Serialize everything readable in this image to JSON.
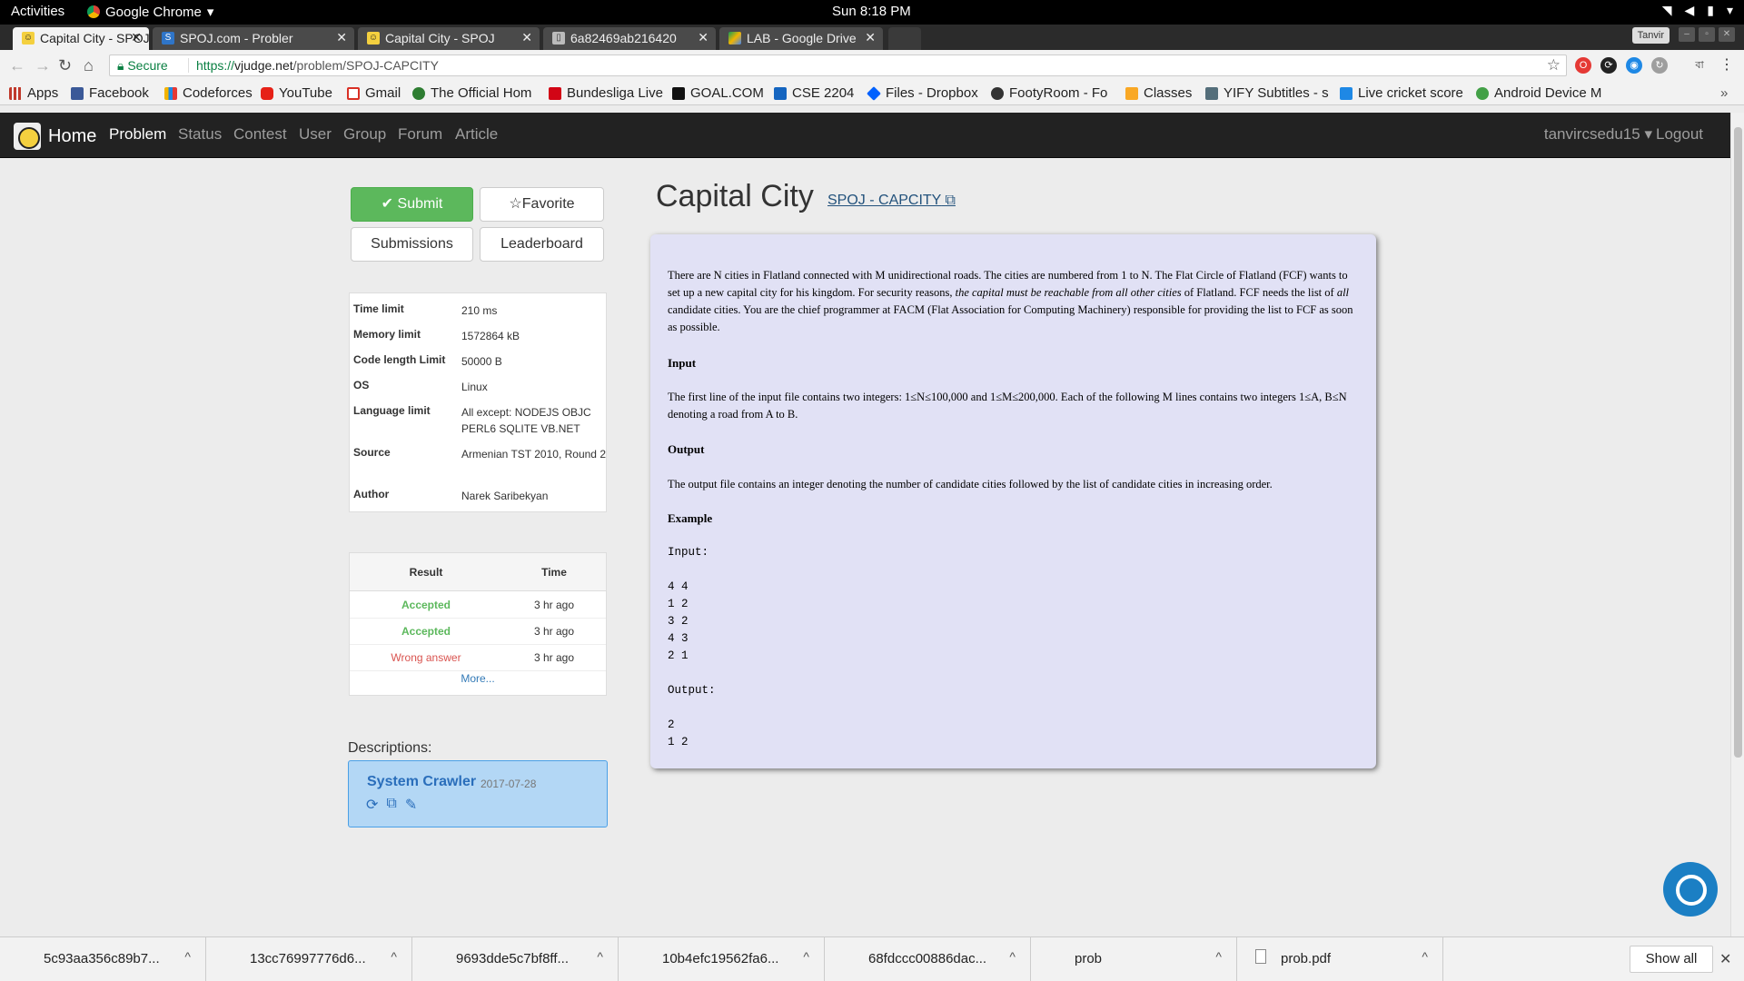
{
  "system": {
    "activities": "Activities",
    "app_name": "Google Chrome",
    "clock": "Sun  8:18 PM"
  },
  "tabs": [
    {
      "title": "Capital City - SPOJ C",
      "active": true
    },
    {
      "title": "SPOJ.com - Probler",
      "active": false
    },
    {
      "title": "Capital City - SPOJ C",
      "active": false
    },
    {
      "title": "6a82469ab216420",
      "active": false
    },
    {
      "title": "LAB - Google Drive",
      "active": false
    }
  ],
  "profile": "Tanvir",
  "address": {
    "secure_label": "Secure",
    "scheme": "https://",
    "host": "vjudge.net",
    "path": "/problem/SPOJ-CAPCITY"
  },
  "bookmarks": [
    "Apps",
    "Facebook",
    "Codeforces",
    "YouTube",
    "Gmail",
    "The Official Hom",
    "Bundesliga Live",
    "GOAL.COM",
    "CSE 2204",
    "Files - Dropbox",
    "FootyRoom - Fo",
    "Classes",
    "YIFY Subtitles - s",
    "Live cricket score",
    "Android Device M"
  ],
  "navbar": {
    "brand": "Home",
    "links": [
      "Problem",
      "Status",
      "Contest",
      "User",
      "Group",
      "Forum",
      "Article"
    ],
    "active": "Problem",
    "user": "tanvircsedu15",
    "logout": "Logout"
  },
  "actions": {
    "submit": "Submit",
    "favorite": "Favorite",
    "submissions": "Submissions",
    "leaderboard": "Leaderboard"
  },
  "info": [
    {
      "key": "Time limit",
      "value": "210 ms"
    },
    {
      "key": "Memory limit",
      "value": "1572864 kB"
    },
    {
      "key": "Code length Limit",
      "value": "50000 B"
    },
    {
      "key": "OS",
      "value": "Linux"
    },
    {
      "key": "Language limit",
      "value": "All except: NODEJS OBJC PERL6 SQLITE VB.NET"
    },
    {
      "key": "Source",
      "value": "Armenian TST 2010, Round 2"
    },
    {
      "key": "Author",
      "value": "Narek Saribekyan"
    }
  ],
  "results": {
    "col_result": "Result",
    "col_time": "Time",
    "rows": [
      {
        "result": "Accepted",
        "time": "3 hr ago",
        "status": "ok"
      },
      {
        "result": "Accepted",
        "time": "3 hr ago",
        "status": "ok"
      },
      {
        "result": "Wrong answer",
        "time": "3 hr ago",
        "status": "bad"
      }
    ],
    "more": "More..."
  },
  "descriptions": {
    "label": "Descriptions:",
    "name": "System Crawler",
    "date": "2017-07-28"
  },
  "problem": {
    "title": "Capital City",
    "source_link": "SPOJ - CAPCITY",
    "intro_a": "There are N cities in Flatland connected with M unidirectional roads. The cities are numbered from 1 to N. The Flat Circle of Flatland (FCF) wants to set up a new capital city for his kingdom. For security reasons, ",
    "intro_em": "the capital must be reachable from all other cities",
    "intro_b": " of Flatland. FCF needs the list of ",
    "intro_em2": "all",
    "intro_c": " candidate cities. You are the chief programmer at FACM (Flat Association for Computing Machinery) responsible for providing the list to FCF as soon as possible.",
    "input_heading": "Input",
    "input_text": "The first line of the input file contains two integers: 1≤N≤100,000 and 1≤M≤200,000. Each of the following M lines contains two integers 1≤A, B≤N denoting a road from A to B.",
    "output_heading": "Output",
    "output_text": "The output file contains an integer denoting the number of candidate cities followed by the list of candidate cities in increasing order.",
    "example_heading": "Example",
    "example_input_label": "Input:",
    "example_input": "4 4\n1 2\n3 2\n4 3\n2 1",
    "example_output_label": "Output:",
    "example_output": "2\n1 2"
  },
  "downloads": {
    "items": [
      "5c93aa356c89b7...",
      "13cc76997776d6...",
      "9693dde5c7bf8ff...",
      "10b4efc19562fa6...",
      "68fdccc00886dac...",
      "prob",
      "prob.pdf"
    ],
    "show_all": "Show all"
  },
  "colors": {
    "navbar": "#222222",
    "accepted": "#5cb85c",
    "wrong": "#d9534f",
    "problem_bg": "#e1e1f5",
    "link": "#337ab7"
  }
}
